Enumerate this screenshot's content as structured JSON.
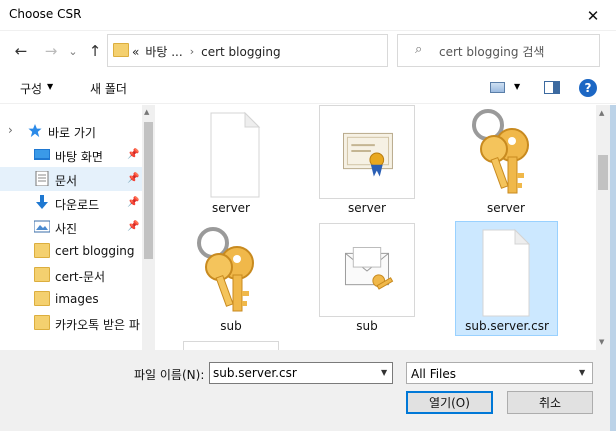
{
  "window": {
    "title": "Choose CSR",
    "close_glyph": "✕"
  },
  "nav": {
    "back_glyph": "←",
    "forward_glyph": "→",
    "recent_glyph": "⌄",
    "up_glyph": "↑"
  },
  "address": {
    "prefix": "«",
    "crumbs": [
      "바탕 ...",
      "cert blogging"
    ],
    "separator": "›",
    "drop_glyph": "⌄",
    "refresh_glyph": "↻"
  },
  "search": {
    "placeholder": "cert blogging 검색",
    "icon_glyph": "⌕"
  },
  "toolbar": {
    "organize_label": "구성",
    "organize_arrow": "▼",
    "new_folder_label": "새 폴더",
    "view_arrow": "▼",
    "help_glyph": "?"
  },
  "sidebar": {
    "items": [
      {
        "label": "바로 가기",
        "pinned": false
      },
      {
        "label": "바탕 화면",
        "pinned": true
      },
      {
        "label": "문서",
        "pinned": true
      },
      {
        "label": "다운로드",
        "pinned": true
      },
      {
        "label": "사진",
        "pinned": true
      },
      {
        "label": "cert blogging",
        "pinned": false
      },
      {
        "label": "cert-문서",
        "pinned": false
      },
      {
        "label": "images",
        "pinned": false
      },
      {
        "label": "카카오톡 받은 파",
        "pinned": false
      }
    ],
    "pin_glyph": "📌",
    "expand_glyph": "›"
  },
  "files": [
    {
      "name": "server",
      "kind": "blank-doc"
    },
    {
      "name": "server",
      "kind": "certificate"
    },
    {
      "name": "server",
      "kind": "keys"
    },
    {
      "name": "sub",
      "kind": "keys"
    },
    {
      "name": "sub",
      "kind": "envelope-key"
    },
    {
      "name": "sub.server.csr",
      "kind": "blank-doc",
      "selected": true
    }
  ],
  "bottom": {
    "filename_label": "파일 이름(N):",
    "filename_value": "sub.server.csr",
    "filetype_value": "All Files",
    "open_label": "열기(O)",
    "cancel_label": "취소"
  },
  "colors": {
    "selection": "#cce8ff",
    "accent": "#0078d7",
    "folder": "#f4d06f"
  }
}
